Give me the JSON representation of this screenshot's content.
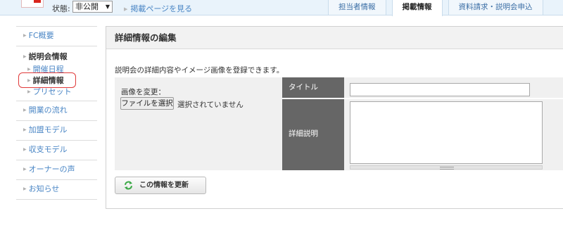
{
  "topbar": {
    "status_label": "状態:",
    "status_value": "非公開",
    "view_page_link": "掲載ページを見る",
    "tabs": [
      {
        "label": "担当者情報",
        "active": false
      },
      {
        "label": "掲載情報",
        "active": true
      },
      {
        "label": "資料請求・説明会申込",
        "active": false
      }
    ]
  },
  "sidebar": {
    "fc_overview": "FC概要",
    "briefing_group": {
      "heading": "説明会情報",
      "items": [
        {
          "label": "開催日程"
        },
        {
          "label": "詳細情報",
          "current": true
        },
        {
          "label": "プリセット"
        }
      ]
    },
    "items": [
      {
        "label": "開業の流れ"
      },
      {
        "label": "加盟モデル"
      },
      {
        "label": "収支モデル"
      },
      {
        "label": "オーナーの声"
      },
      {
        "label": "お知らせ"
      }
    ]
  },
  "main": {
    "title": "詳細情報の編集",
    "description": "説明会の詳細内容やイメージ画像を登録できます。",
    "image_label": "画像を変更：",
    "file_button": "ファイルを選択",
    "file_status": "選択されていません",
    "field_title_label": "タイトル",
    "field_title_value": "",
    "field_detail_label": "詳細説明",
    "field_detail_value": "",
    "update_button": "この情報を更新"
  },
  "colors": {
    "link": "#4a86c5",
    "label_bg": "#666666",
    "highlight": "#e03a3a",
    "icon_green": "#3aa845"
  }
}
